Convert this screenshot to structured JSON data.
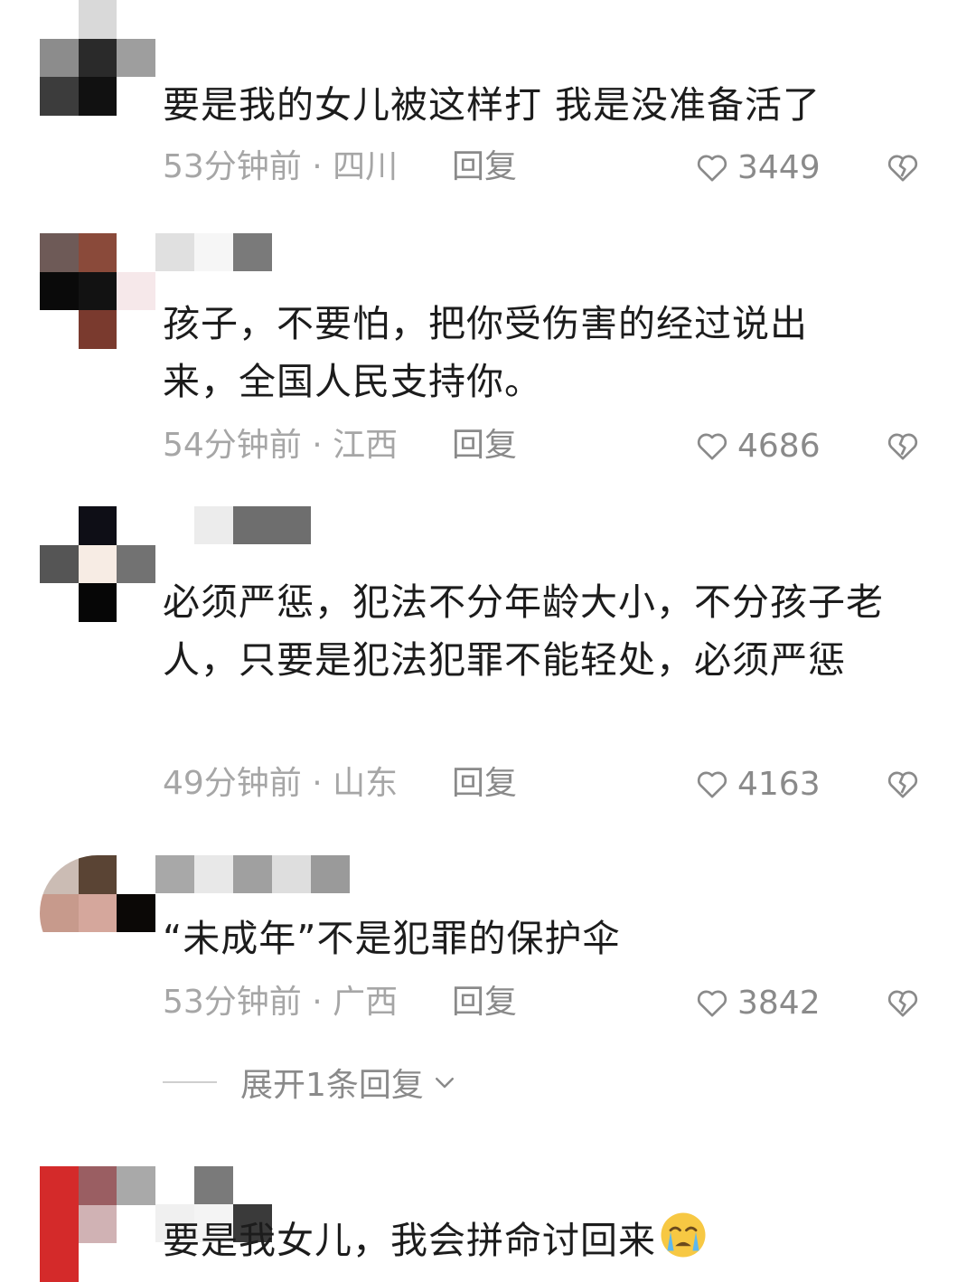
{
  "comments": [
    {
      "text": "要是我的女儿被这样打 我是没准备活了",
      "time_location": "53分钟前 · 四川",
      "reply_label": "回复",
      "likes": "3449"
    },
    {
      "text": "孩子，不要怕，把你受伤害的经过说出来，全国人民支持你。",
      "time_location": "54分钟前 · 江西",
      "reply_label": "回复",
      "likes": "4686"
    },
    {
      "text": "必须严惩，犯法不分年龄大小，不分孩子老人，只要是犯法犯罪不能轻处，必须严惩",
      "time_location": "49分钟前 · 山东",
      "reply_label": "回复",
      "likes": "4163"
    },
    {
      "text": "“未成年”不是犯罪的保护伞",
      "time_location": "53分钟前 · 广西",
      "reply_label": "回复",
      "likes": "3842",
      "expand_label": "展开1条回复"
    },
    {
      "text": "要是我女儿，我会拼命讨回来"
    }
  ],
  "colors": {
    "text": "#1c1c1c",
    "meta": "#a6a6a6",
    "action": "#8a8a8a"
  },
  "icons": {
    "like": "heart-outline-icon",
    "dislike": "broken-heart-icon",
    "expand": "chevron-down-icon",
    "emoji": "crying-face-emoji"
  }
}
